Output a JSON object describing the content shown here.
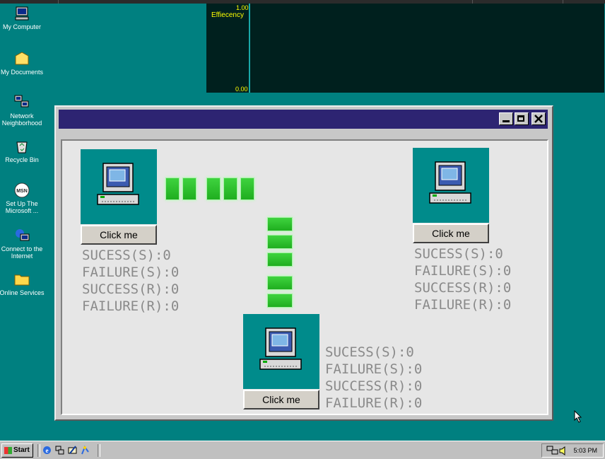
{
  "desktop": {
    "icons": [
      {
        "label": "My Computer",
        "icon": "computer-icon"
      },
      {
        "label": "My Documents",
        "icon": "folder-icon"
      },
      {
        "label": "Network Neighborhood",
        "icon": "network-icon"
      },
      {
        "label": "Recycle Bin",
        "icon": "recycle-bin-icon"
      },
      {
        "label": "Set Up The Microsoft ...",
        "icon": "msn-icon"
      },
      {
        "label": "Connect to the Internet",
        "icon": "internet-icon"
      },
      {
        "label": "Online Services",
        "icon": "folder-icon"
      }
    ]
  },
  "efficiency": {
    "label": "Effiecency",
    "max": "1.00",
    "min": "0.00"
  },
  "window": {
    "colors": {
      "titlebar": "#2d2472",
      "tile": "#008b8b",
      "packet": "#2fc02f"
    },
    "nodes": [
      {
        "button": "Click me",
        "stats": [
          "SUCESS(S):0",
          "FAILURE(S):0",
          "SUCCESS(R):0",
          "FAILURE(R):0"
        ]
      },
      {
        "button": "Click me",
        "stats": [
          "SUCESS(S):0",
          "FAILURE(S):0",
          "SUCCESS(R):0",
          "FAILURE(R):0"
        ]
      },
      {
        "button": "Click me",
        "stats": [
          "SUCESS(S):0",
          "FAILURE(S):0",
          "SUCCESS(R):0",
          "FAILURE(R):0"
        ]
      }
    ]
  },
  "taskbar": {
    "start": "Start",
    "time": "5:03 PM"
  }
}
